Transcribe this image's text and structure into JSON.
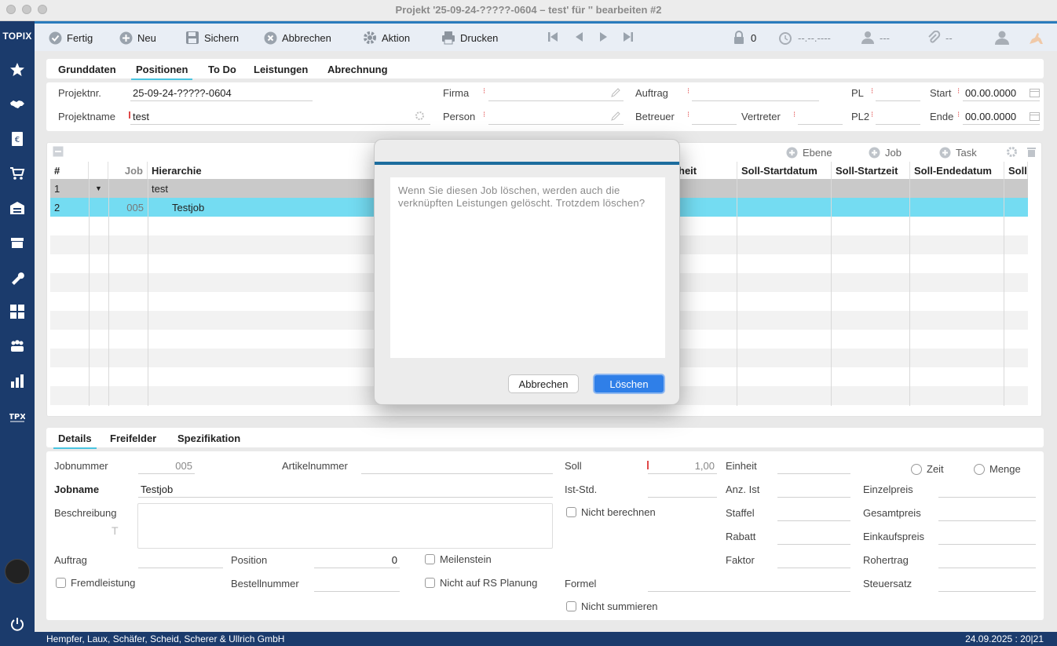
{
  "window": {
    "title": "Projekt '25-09-24-?????-0604 – test' für '' bearbeiten #2"
  },
  "sidebar": {
    "logo": "TOPIX"
  },
  "toolbar": {
    "fertig": "Fertig",
    "neu": "Neu",
    "sichern": "Sichern",
    "abbrechen": "Abbrechen",
    "aktion": "Aktion",
    "drucken": "Drucken",
    "lock_count": "0",
    "date": "--.--.----",
    "user": "---",
    "attach": "--"
  },
  "tabs": [
    "Grunddaten",
    "Positionen",
    "To Do",
    "Leistungen",
    "Abrechnung"
  ],
  "header": {
    "projektnr_label": "Projektnr.",
    "projektnr": "25-09-24-?????-0604",
    "projektname_label": "Projektname",
    "projektname": "test",
    "firma_label": "Firma",
    "person_label": "Person",
    "auftrag_label": "Auftrag",
    "betreuer_label": "Betreuer",
    "vertreter_label": "Vertreter",
    "pl_label": "PL",
    "pl2_label": "PL2",
    "start_label": "Start",
    "start": "00.00.0000",
    "ende_label": "Ende",
    "ende": "00.00.0000"
  },
  "grid_toolbar": {
    "ebene": "Ebene",
    "job": "Job",
    "task": "Task"
  },
  "grid": {
    "headers": [
      "#",
      "",
      "Job",
      "Hierarchie",
      "heit",
      "Soll-Startdatum",
      "Soll-Startzeit",
      "Soll-Endedatum",
      "Soll-"
    ],
    "rows": [
      {
        "num": "1",
        "job": "",
        "hier": "test"
      },
      {
        "num": "2",
        "job": "005",
        "hier": "Testjob"
      }
    ]
  },
  "dialog": {
    "message": "Wenn Sie diesen Job löschen, werden auch die verknüpften Leistungen gelöscht. Trotzdem löschen?",
    "cancel": "Abbrechen",
    "confirm": "Löschen"
  },
  "detail_tabs": [
    "Details",
    "Freifelder",
    "Spezifikation"
  ],
  "details": {
    "jobnummer_label": "Jobnummer",
    "jobnummer": "005",
    "artikelnummer_label": "Artikelnummer",
    "jobname_label": "Jobname",
    "jobname": "Testjob",
    "beschreibung_label": "Beschreibung",
    "auftrag_label": "Auftrag",
    "position_label": "Position",
    "position": "0",
    "meilenstein": "Meilenstein",
    "fremdleistung": "Fremdleistung",
    "bestellnummer_label": "Bestellnummer",
    "nicht_rs": "Nicht auf RS Planung",
    "soll_label": "Soll",
    "soll": "1,00",
    "ist_label": "Ist-Std.",
    "nicht_berechnen": "Nicht berechnen",
    "formel_label": "Formel",
    "nicht_summieren": "Nicht summieren",
    "einheit_label": "Einheit",
    "anz_ist_label": "Anz. Ist",
    "staffel_label": "Staffel",
    "rabatt_label": "Rabatt",
    "faktor_label": "Faktor",
    "zeit": "Zeit",
    "menge": "Menge",
    "einzelpreis_label": "Einzelpreis",
    "gesamtpreis_label": "Gesamtpreis",
    "einkaufspreis_label": "Einkaufspreis",
    "rohertrag_label": "Rohertrag",
    "steuersatz_label": "Steuersatz"
  },
  "status": {
    "company": "Hempfer, Laux, Schäfer, Scheid, Scherer & Ullrich GmbH",
    "datetime": "24.09.2025 : 20|21"
  }
}
